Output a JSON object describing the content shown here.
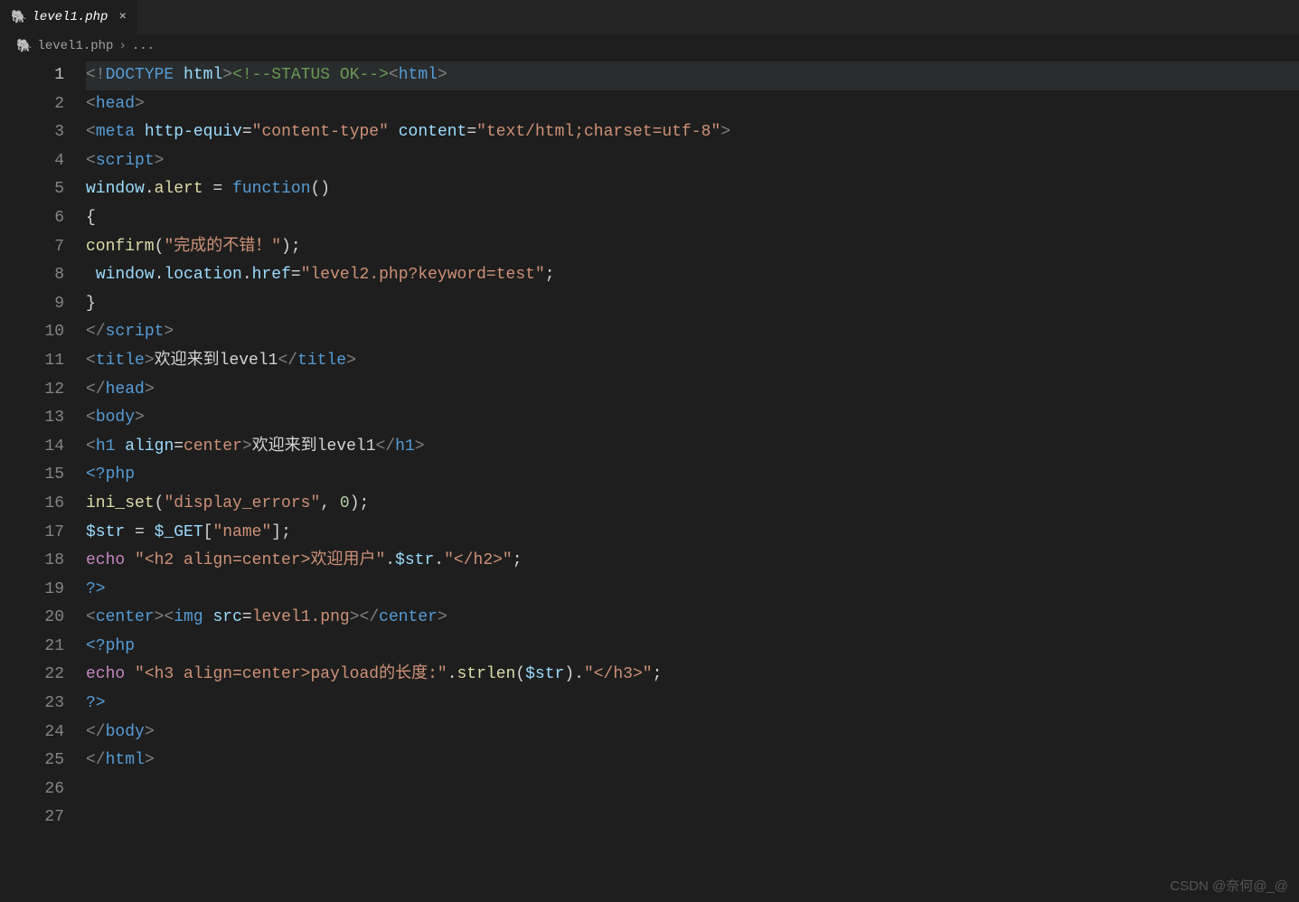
{
  "tab": {
    "icon": "🐘",
    "name": "level1.php",
    "close": "×"
  },
  "breadcrumb": {
    "icon": "🐘",
    "file": "level1.php",
    "sep": "›",
    "rest": "..."
  },
  "gutter": [
    "1",
    "2",
    "3",
    "4",
    "5",
    "6",
    "7",
    "8",
    "9",
    "10",
    "11",
    "12",
    "13",
    "14",
    "15",
    "16",
    "17",
    "18",
    "19",
    "20",
    "21",
    "22",
    "23",
    "24",
    "25",
    "26",
    "27"
  ],
  "lines": {
    "l1": {
      "p1": "<!",
      "p2": "DOCTYPE",
      "p3": " ",
      "p4": "html",
      "p5": ">",
      "p6": "<!--STATUS OK-->",
      "p7": "<",
      "p8": "html",
      "p9": ">"
    },
    "l2": {
      "p1": "<",
      "p2": "head",
      "p3": ">"
    },
    "l3": {
      "p1": "<",
      "p2": "meta",
      "p3": " ",
      "p4": "http-equiv",
      "p5": "=",
      "p6": "\"content-type\"",
      "p7": " ",
      "p8": "content",
      "p9": "=",
      "p10": "\"text/html;charset=utf-8\"",
      "p11": ">"
    },
    "l4": {
      "p1": "<",
      "p2": "script",
      "p3": ">"
    },
    "l5": {
      "p1": "window",
      "p2": ".",
      "p3": "alert",
      "p4": " ",
      "p5": "=",
      "p6": " ",
      "p7": "function",
      "p8": "()"
    },
    "l6": {
      "p1": "{"
    },
    "l7": {
      "p1": "confirm",
      "p2": "(",
      "p3": "\"完成的不错！\"",
      "p4": ");"
    },
    "l8": {
      "p1": " ",
      "p2": "window",
      "p3": ".",
      "p4": "location",
      "p5": ".",
      "p6": "href",
      "p7": "=",
      "p8": "\"level2.php?keyword=test\"",
      "p9": ";"
    },
    "l9": {
      "p1": "}"
    },
    "l10": {
      "p1": "</",
      "p2": "script",
      "p3": ">"
    },
    "l11": {
      "p1": "<",
      "p2": "title",
      "p3": ">",
      "p4": "欢迎来到level1",
      "p5": "</",
      "p6": "title",
      "p7": ">"
    },
    "l12": {
      "p1": "</",
      "p2": "head",
      "p3": ">"
    },
    "l13": {
      "p1": "<",
      "p2": "body",
      "p3": ">"
    },
    "l14": {
      "p1": "<",
      "p2": "h1",
      "p3": " ",
      "p4": "align",
      "p5": "=",
      "p6": "center",
      "p7": ">",
      "p8": "欢迎来到level1",
      "p9": "</",
      "p10": "h1",
      "p11": ">"
    },
    "l15": {
      "p1": "<?",
      "p2": "php",
      "p3": " "
    },
    "l16": {
      "p1": "ini_set",
      "p2": "(",
      "p3": "\"display_errors\"",
      "p4": ", ",
      "p5": "0",
      "p6": ");"
    },
    "l17": {
      "p1": "$str",
      "p2": " = ",
      "p3": "$_GET",
      "p4": "[",
      "p5": "\"name\"",
      "p6": "];"
    },
    "l18": {
      "p1": "echo",
      "p2": " ",
      "p3": "\"<h2 align=center>欢迎用户\"",
      "p4": ".",
      "p5": "$str",
      "p6": ".",
      "p7": "\"</h2>\"",
      "p8": ";"
    },
    "l19": {
      "p1": "?>"
    },
    "l20": {
      "p1": "<",
      "p2": "center",
      "p3": ">",
      "p4": "<",
      "p5": "img",
      "p6": " ",
      "p7": "src",
      "p8": "=",
      "p9": "level1.png",
      "p10": ">",
      "p11": "</",
      "p12": "center",
      "p13": ">"
    },
    "l21": {
      "p1": "<?",
      "p2": "php",
      "p3": " "
    },
    "l22": {
      "p1": "echo",
      "p2": " ",
      "p3": "\"<h3 align=center>payload的长度:\"",
      "p4": ".",
      "p5": "strlen",
      "p6": "(",
      "p7": "$str",
      "p8": ").",
      "p9": "\"</h3>\"",
      "p10": ";"
    },
    "l23": {
      "p1": "?>"
    },
    "l24": {
      "p1": "</",
      "p2": "body",
      "p3": ">"
    },
    "l25": {
      "p1": "</",
      "p2": "html",
      "p3": ">"
    }
  },
  "watermark": "CSDN @奈何@_@"
}
